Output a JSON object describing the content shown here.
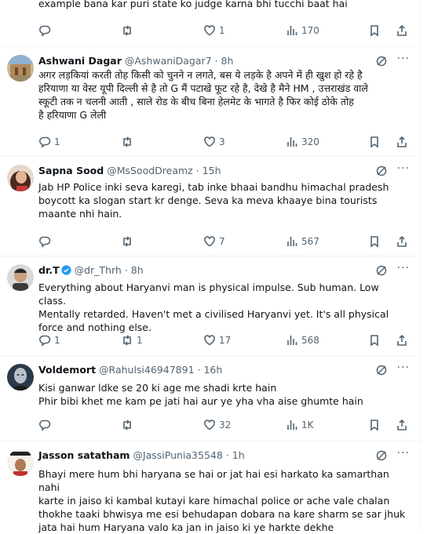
{
  "top_tweet": {
    "text_tail": "example bana kar puri state ko judge karna bhi tucchi baat hai",
    "replies": "",
    "retweets": "",
    "likes": "1",
    "views": "170"
  },
  "tweets": [
    {
      "name": "Ashwani Dagar",
      "handle": "@AshwaniDagar7",
      "time": "· 8h",
      "text": "अगर लड़कियां करती तोह किसी को चुनने न लगते, बस ये लड़के है अपने में ही खुश हो रहे है\nहरियाणा या वेस्ट यूपी दिल्ली से है तो G मैं पटाखे फूट रहे है, देखे है मैने HM , उत्तराखंड वाले\nस्कूटी तक न चलनी आती , साले रोड के बीच बिना हेलमेट के भागते है फिर कोई ठोके तोह\nहै हरियाणा G लेली",
      "replies": "1",
      "retweets": "",
      "likes": "3",
      "views": "320"
    },
    {
      "name": "Sapna Sood",
      "handle": "@MsSoodDreamz",
      "time": "· 15h",
      "text": "Jab HP Police inki seva karegi, tab inke bhaai bandhu himachal pradesh\nboycott ka slogan start kr denge. Seva ka meva khaaye bina tourists\nmaante nhi hain.",
      "replies": "",
      "retweets": "",
      "likes": "7",
      "views": "567"
    },
    {
      "name": "dr.T",
      "handle": "@dr_Thrh",
      "time": "· 8h",
      "text": "Everything about Haryanvi man is physical impulse. Sub human. Low class.\nMentally retarded. Haven't met a civilised Haryanvi yet. It's all physical\nforce and nothing else.",
      "replies": "1",
      "retweets": "1",
      "likes": "17",
      "views": "568"
    },
    {
      "name": "Voldemort",
      "handle": "@Rahulsi46947891",
      "time": "· 16h",
      "text": "Kisi ganwar ldke se 20 ki age me shadi krte hain\nPhir bibi khet me kam pe jati hai aur ye yha vha aise ghumte hain",
      "replies": "",
      "retweets": "",
      "likes": "32",
      "views": "1K"
    },
    {
      "name": "Jasson satatham",
      "handle": "@JassiPunia35548",
      "time": "· 1h",
      "text": "Bhayi mere hum bhi haryana se hai or jat hai esi harkato ka samarthan nahi\nkarte in jaiso ki kambal kutayi kare himachal police or ache vale chalan\nthokhe taaki bhwisya me esi behudapan dobara na kare sharm se sar jhuk\njata hai hum Haryana valo ka jan in jaiso ki ye harkte dekhe",
      "replies": "",
      "retweets": "",
      "likes": "",
      "views": ""
    }
  ],
  "icons": {
    "reply": "reply-icon",
    "retweet": "retweet-icon",
    "like": "heart-icon",
    "views": "views-icon",
    "bookmark": "bookmark-icon",
    "share": "share-icon",
    "grok": "grok-icon",
    "more": "more-icon",
    "verified": "verified-badge-icon"
  },
  "colors": {
    "text": "#0f1419",
    "muted": "#536471",
    "border": "#eff3f4",
    "verified": "#1d9bf0"
  }
}
